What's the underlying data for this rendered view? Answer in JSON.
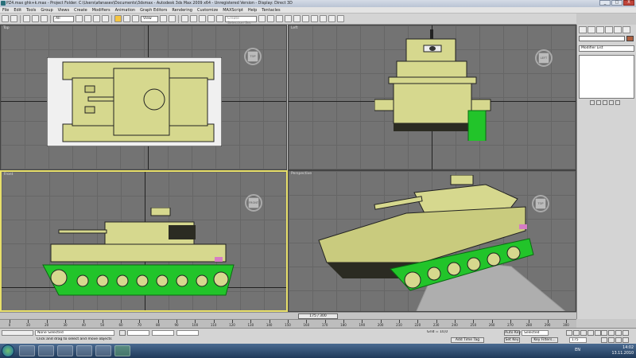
{
  "window": {
    "title": "PZ4.max ghk+k.max - Project Folder: C:\\Users\\afanasev\\Documents\\3dsmax - Autodesk 3ds Max 2009 x64 - Unregistered Version - Display: Direct 3D",
    "buttons": [
      "_",
      "□",
      "X"
    ]
  },
  "menu": [
    "File",
    "Edit",
    "Tools",
    "Group",
    "Views",
    "Create",
    "Modifiers",
    "Animation",
    "Graph Editors",
    "Rendering",
    "Customize",
    "MAXScript",
    "Help",
    "Tentacles"
  ],
  "toolbar": {
    "filter_value": "All",
    "refcoord_value": "View",
    "named_selection_placeholder": "Create Selection Set"
  },
  "viewports": [
    {
      "label": "Top",
      "cube": "TOP"
    },
    {
      "label": "Left",
      "cube": "LEFT"
    },
    {
      "label": "Front",
      "cube": "FRONT"
    },
    {
      "label": "Perspective",
      "cube": "TOP"
    }
  ],
  "command_panel": {
    "modifier_list": "Modifier List"
  },
  "time_slider": {
    "frame_label": "175 / 300"
  },
  "trackbar_ticks": [
    "0",
    "10",
    "20",
    "30",
    "40",
    "50",
    "60",
    "70",
    "80",
    "90",
    "100",
    "110",
    "120",
    "130",
    "140",
    "150",
    "160",
    "170",
    "180",
    "190",
    "200",
    "210",
    "220",
    "230",
    "240",
    "250",
    "260",
    "270",
    "280",
    "290",
    "300"
  ],
  "status": {
    "selection": "None Selected",
    "prompt": "Click and drag to select and move objects",
    "grid": "Grid = 10,0",
    "add_time_tag": "Add Time Tag",
    "auto_key": "Auto Key",
    "set_key": "Set Key",
    "selected_value": "Selected",
    "key_filters": "Key Filters...",
    "frame_value": "175"
  },
  "taskbar": {
    "language": "EN",
    "time": "14:02",
    "date": "13.11.2010"
  },
  "colors": {
    "viewport_bg": "#737373",
    "tank_body": "#d6d88e",
    "tank_shadow": "#2b2b22",
    "track_green": "#22c42a",
    "active_border": "#e8e06a"
  }
}
